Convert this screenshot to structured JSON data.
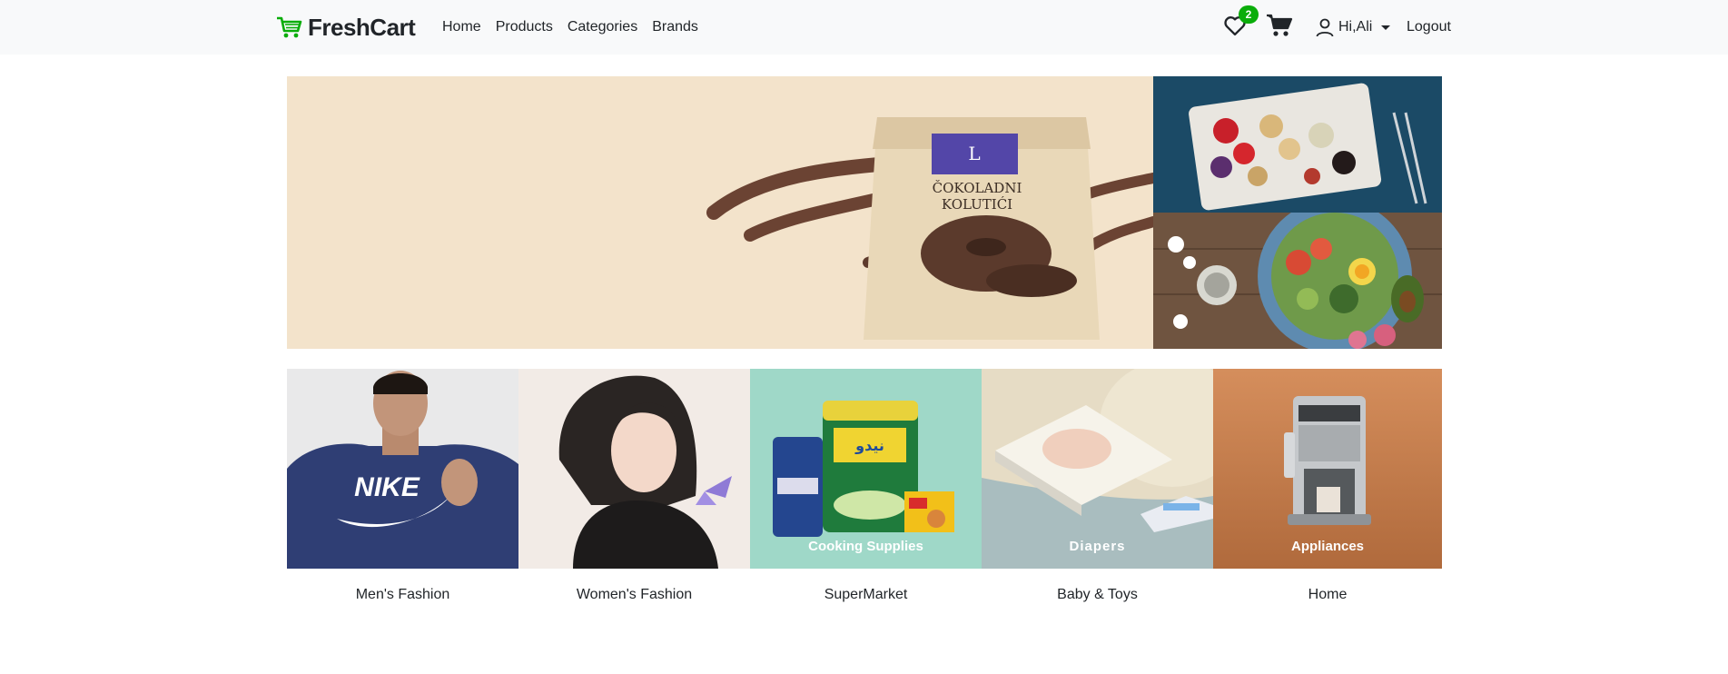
{
  "brand": {
    "name": "FreshCart",
    "color": "#0aad0a"
  },
  "nav": {
    "links": [
      "Home",
      "Products",
      "Categories",
      "Brands"
    ],
    "wishlist_count": "2",
    "user_greeting": "Hi,Ali",
    "logout": "Logout"
  },
  "hero": {
    "main_image": "chocolate-cookie-bag-image",
    "side_top_image": "fruit-cheese-board-image",
    "side_bottom_image": "salad-bowl-image"
  },
  "categories": [
    {
      "name": "Men's Fashion",
      "image": "nike-hoodie-man-image",
      "overlay": ""
    },
    {
      "name": "Women's Fashion",
      "image": "woman-illustration-image",
      "overlay": ""
    },
    {
      "name": "SuperMarket",
      "image": "grocery-products-image",
      "overlay": "Cooking Supplies"
    },
    {
      "name": "Baby & Toys",
      "image": "diapers-image",
      "overlay": "Diapers"
    },
    {
      "name": "Home",
      "image": "coffee-machine-image",
      "overlay": "Appliances"
    }
  ],
  "colors": {
    "navbar_bg": "#f8f9fa",
    "accent": "#0aad0a",
    "text": "#212529"
  }
}
